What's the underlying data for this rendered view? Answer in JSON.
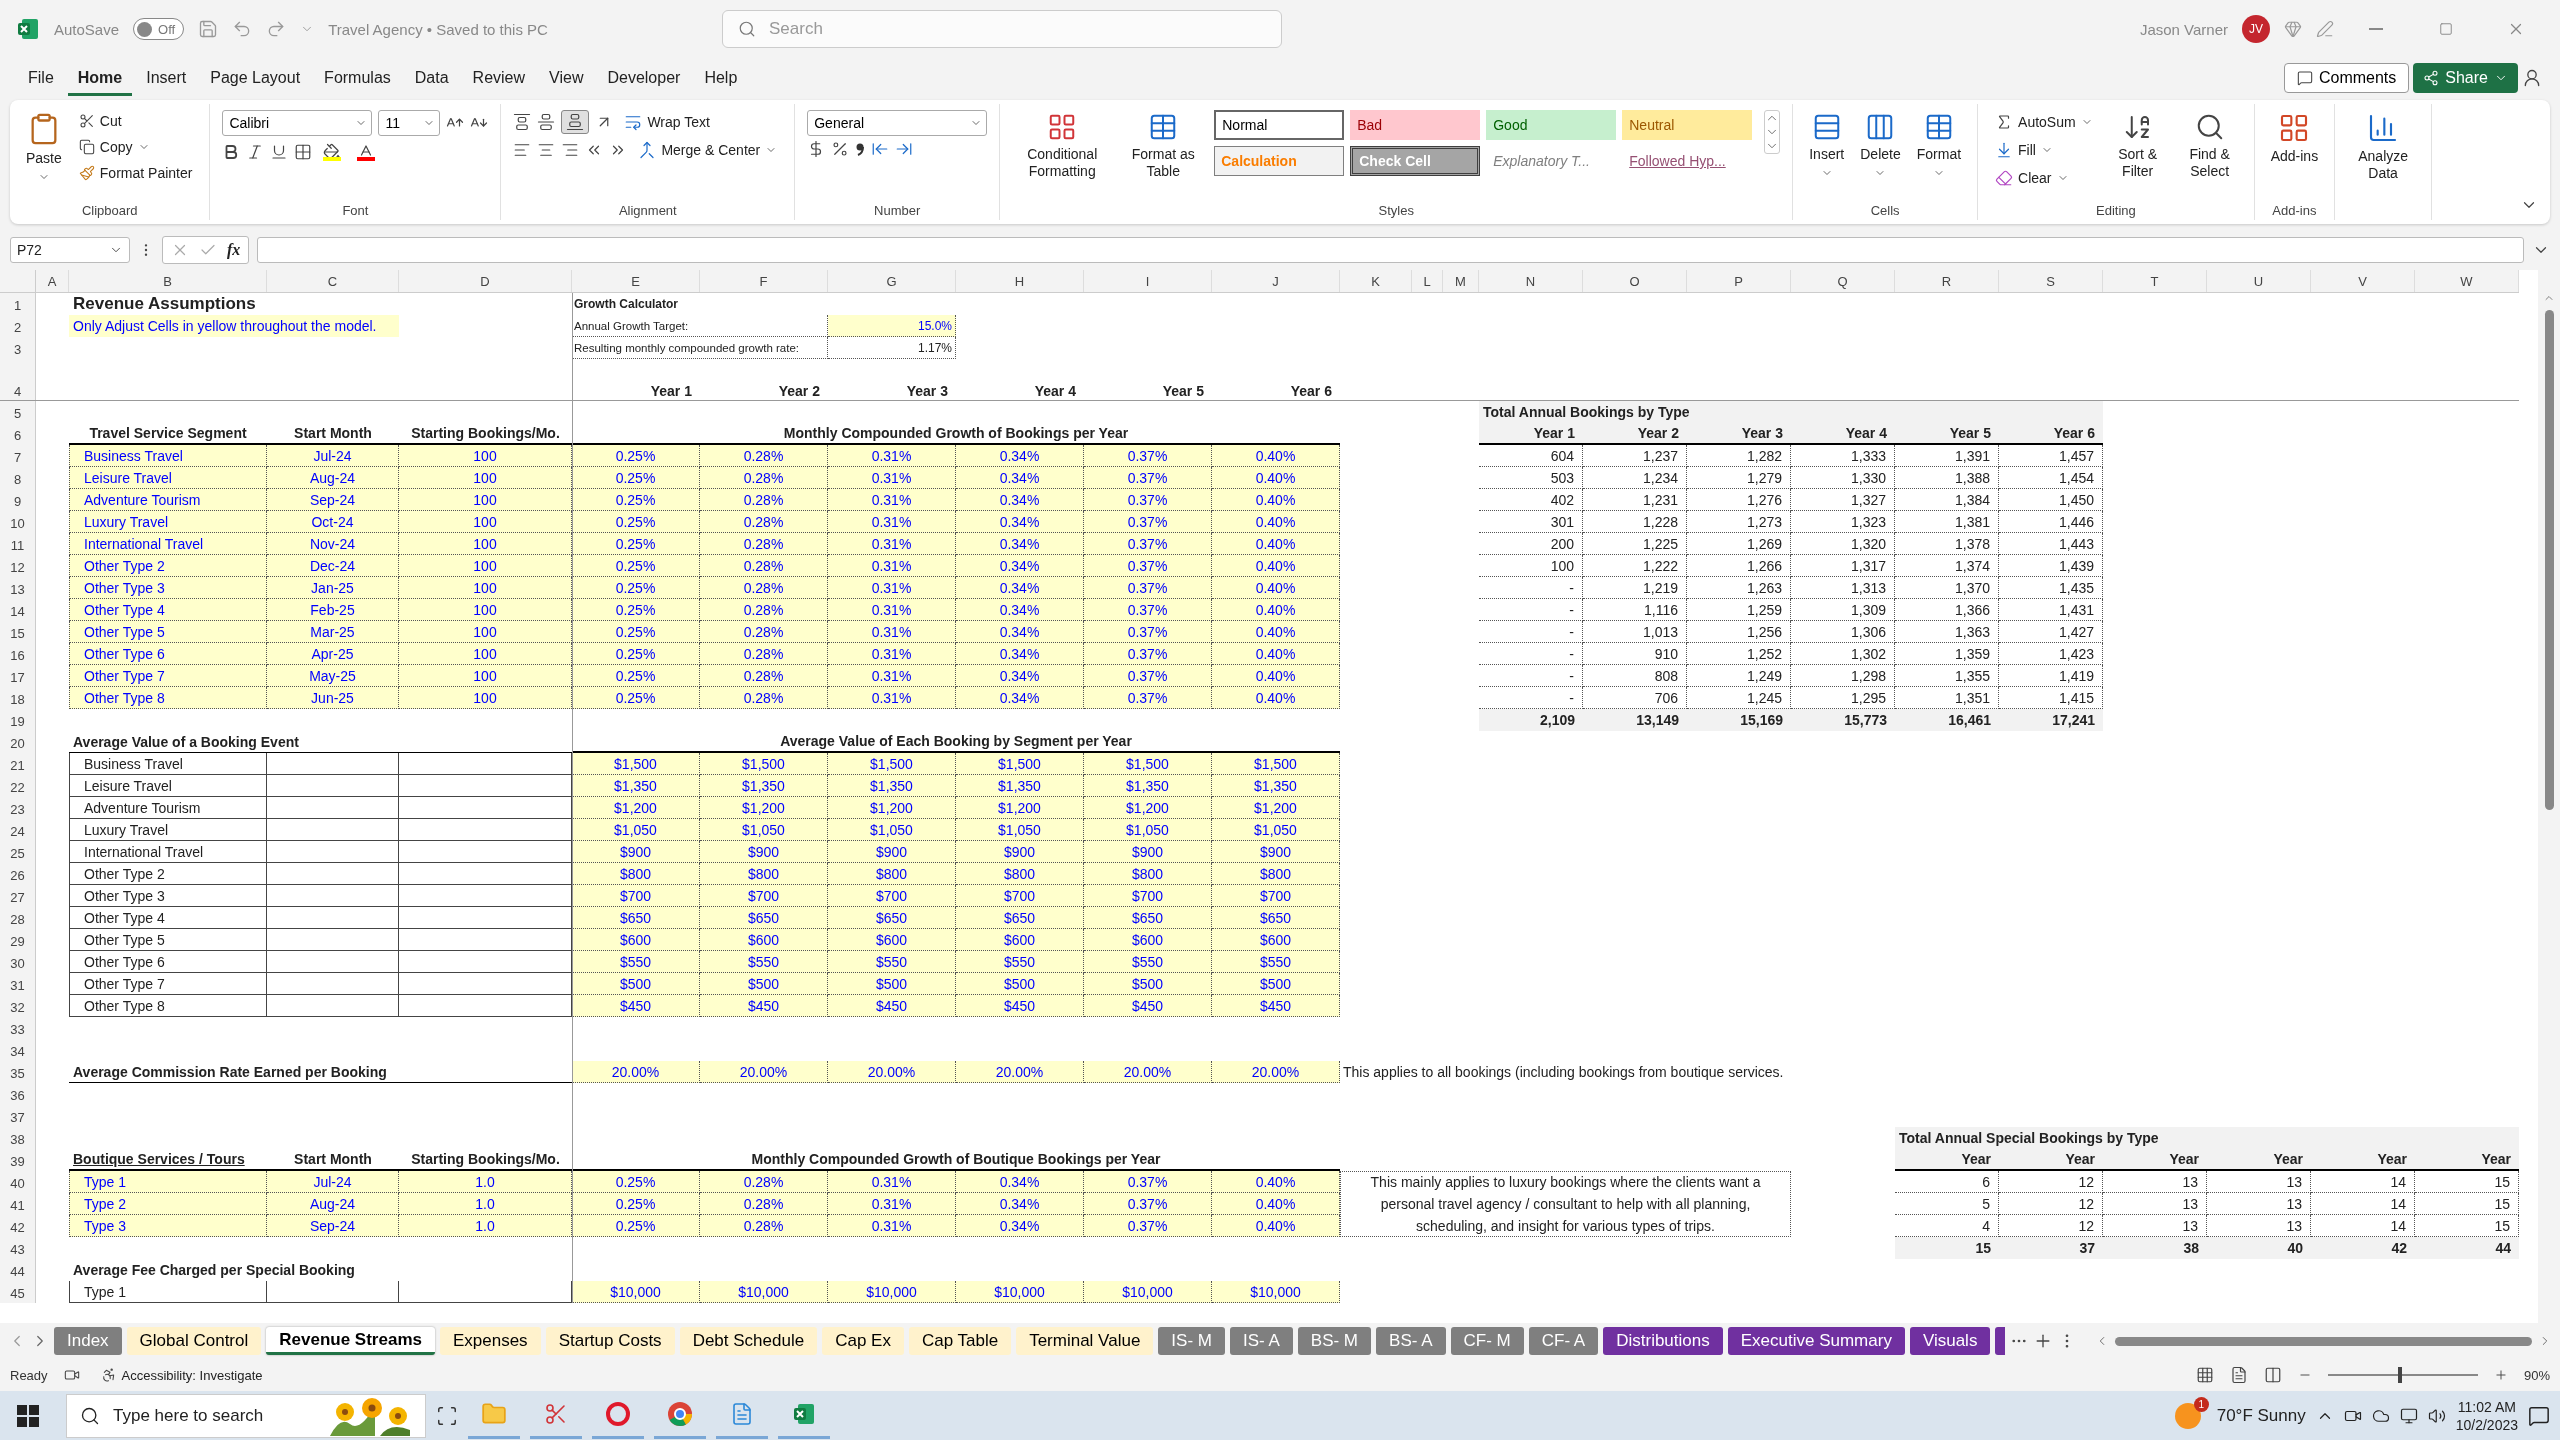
{
  "app": {
    "autosave_label": "AutoSave",
    "autosave_state": "Off",
    "autosave_on": false,
    "document_title": "Travel Agency • Saved to this PC",
    "search_placeholder": "Search",
    "user_name": "Jason Varner",
    "user_initials": "JV"
  },
  "menu_tabs": [
    {
      "label": "File",
      "selected": false
    },
    {
      "label": "Home",
      "selected": true
    },
    {
      "label": "Insert",
      "selected": false
    },
    {
      "label": "Page Layout",
      "selected": false
    },
    {
      "label": "Formulas",
      "selected": false
    },
    {
      "label": "Data",
      "selected": false
    },
    {
      "label": "Review",
      "selected": false
    },
    {
      "label": "View",
      "selected": false
    },
    {
      "label": "Developer",
      "selected": false
    },
    {
      "label": "Help",
      "selected": false
    }
  ],
  "comments_button": "Comments",
  "share_button": "Share",
  "ribbon": {
    "clipboard": {
      "label": "Clipboard",
      "paste": "Paste",
      "cut": "Cut",
      "copy": "Copy",
      "format_painter": "Format Painter"
    },
    "font": {
      "label": "Font",
      "font_name": "Calibri",
      "font_size": "11"
    },
    "alignment": {
      "label": "Alignment",
      "wrap_text": "Wrap Text",
      "merge": "Merge & Center",
      "bottom_align_selected": true
    },
    "number": {
      "label": "Number",
      "format": "General"
    },
    "styles": {
      "label": "Styles",
      "conditional": "Conditional Formatting",
      "format_table": "Format as Table",
      "cell_styles": [
        {
          "label": "Normal",
          "kind": "normal",
          "selected": true
        },
        {
          "label": "Bad",
          "kind": "bad",
          "selected": false
        },
        {
          "label": "Good",
          "kind": "good",
          "selected": false
        },
        {
          "label": "Neutral",
          "kind": "neutral",
          "selected": false
        },
        {
          "label": "Calculation",
          "kind": "calculation",
          "selected": false
        },
        {
          "label": "Check Cell",
          "kind": "check",
          "selected": false
        },
        {
          "label": "Explanatory T...",
          "kind": "explanatory",
          "selected": false
        },
        {
          "label": "Followed Hyp...",
          "kind": "followed",
          "selected": false
        }
      ]
    },
    "cells": {
      "label": "Cells",
      "insert": "Insert",
      "delete": "Delete",
      "format": "Format"
    },
    "editing": {
      "label": "Editing",
      "autosum": "AutoSum",
      "fill": "Fill",
      "clear": "Clear",
      "sort": "Sort & Filter",
      "find": "Find & Select"
    },
    "addins": {
      "label": "Add-ins",
      "button": "Add-ins"
    },
    "analyze": {
      "button": "Analyze Data"
    }
  },
  "formula_bar": {
    "name_box": "P72",
    "fx": "fx"
  },
  "columns": [
    "A",
    "B",
    "C",
    "D",
    "E",
    "F",
    "G",
    "H",
    "I",
    "J",
    "K",
    "L",
    "M",
    "N",
    "O",
    "P",
    "Q",
    "R",
    "S",
    "T",
    "U",
    "V",
    "W"
  ],
  "row_numbers": [
    "1",
    "2",
    "3",
    "4",
    "5",
    "6",
    "7",
    "8",
    "9",
    "10",
    "11",
    "12",
    "13",
    "14",
    "15",
    "16",
    "17",
    "18",
    "19",
    "20",
    "21",
    "22",
    "23",
    "24",
    "25",
    "26",
    "27",
    "28",
    "29",
    "30",
    "31",
    "32",
    "33",
    "34",
    "35",
    "36",
    "37",
    "38",
    "39",
    "40",
    "41",
    "42",
    "43",
    "44",
    "45"
  ],
  "sheet": {
    "title": "Revenue Assumptions",
    "instruction": "Only Adjust Cells in yellow throughout the model.",
    "calculator": {
      "title": "Growth Calculator",
      "rows": [
        {
          "label": "Annual Growth Target:",
          "value": "15.0%",
          "kind": "input"
        },
        {
          "label": "Resulting monthly compounded growth rate:",
          "value": "1.17%",
          "kind": "result"
        }
      ]
    },
    "year_headers": [
      "Year 1",
      "Year 2",
      "Year 3",
      "Year 4",
      "Year 5",
      "Year 6"
    ],
    "segments": {
      "headers": [
        "Travel Service Segment",
        "Start Month",
        "Starting Bookings/Mo."
      ],
      "growth_header": "Monthly Compounded Growth of Bookings per Year",
      "rows": [
        [
          "Business Travel",
          "Jul-24",
          "100",
          "0.25%",
          "0.28%",
          "0.31%",
          "0.34%",
          "0.37%",
          "0.40%"
        ],
        [
          "Leisure Travel",
          "Aug-24",
          "100",
          "0.25%",
          "0.28%",
          "0.31%",
          "0.34%",
          "0.37%",
          "0.40%"
        ],
        [
          "Adventure Tourism",
          "Sep-24",
          "100",
          "0.25%",
          "0.28%",
          "0.31%",
          "0.34%",
          "0.37%",
          "0.40%"
        ],
        [
          "Luxury Travel",
          "Oct-24",
          "100",
          "0.25%",
          "0.28%",
          "0.31%",
          "0.34%",
          "0.37%",
          "0.40%"
        ],
        [
          "International Travel",
          "Nov-24",
          "100",
          "0.25%",
          "0.28%",
          "0.31%",
          "0.34%",
          "0.37%",
          "0.40%"
        ],
        [
          "Other Type 2",
          "Dec-24",
          "100",
          "0.25%",
          "0.28%",
          "0.31%",
          "0.34%",
          "0.37%",
          "0.40%"
        ],
        [
          "Other Type 3",
          "Jan-25",
          "100",
          "0.25%",
          "0.28%",
          "0.31%",
          "0.34%",
          "0.37%",
          "0.40%"
        ],
        [
          "Other Type 4",
          "Feb-25",
          "100",
          "0.25%",
          "0.28%",
          "0.31%",
          "0.34%",
          "0.37%",
          "0.40%"
        ],
        [
          "Other Type 5",
          "Mar-25",
          "100",
          "0.25%",
          "0.28%",
          "0.31%",
          "0.34%",
          "0.37%",
          "0.40%"
        ],
        [
          "Other Type 6",
          "Apr-25",
          "100",
          "0.25%",
          "0.28%",
          "0.31%",
          "0.34%",
          "0.37%",
          "0.40%"
        ],
        [
          "Other Type 7",
          "May-25",
          "100",
          "0.25%",
          "0.28%",
          "0.31%",
          "0.34%",
          "0.37%",
          "0.40%"
        ],
        [
          "Other Type 8",
          "Jun-25",
          "100",
          "0.25%",
          "0.28%",
          "0.31%",
          "0.34%",
          "0.37%",
          "0.40%"
        ]
      ]
    },
    "annual_bookings": {
      "title": "Total Annual Bookings by Type",
      "years": [
        "Year 1",
        "Year 2",
        "Year 3",
        "Year 4",
        "Year 5",
        "Year 6"
      ],
      "rows": [
        [
          "604",
          "1,237",
          "1,282",
          "1,333",
          "1,391",
          "1,457"
        ],
        [
          "503",
          "1,234",
          "1,279",
          "1,330",
          "1,388",
          "1,454"
        ],
        [
          "402",
          "1,231",
          "1,276",
          "1,327",
          "1,384",
          "1,450"
        ],
        [
          "301",
          "1,228",
          "1,273",
          "1,323",
          "1,381",
          "1,446"
        ],
        [
          "200",
          "1,225",
          "1,269",
          "1,320",
          "1,378",
          "1,443"
        ],
        [
          "100",
          "1,222",
          "1,266",
          "1,317",
          "1,374",
          "1,439"
        ],
        [
          "-",
          "1,219",
          "1,263",
          "1,313",
          "1,370",
          "1,435"
        ],
        [
          "-",
          "1,116",
          "1,259",
          "1,309",
          "1,366",
          "1,431"
        ],
        [
          "-",
          "1,013",
          "1,256",
          "1,306",
          "1,363",
          "1,427"
        ],
        [
          "-",
          "910",
          "1,252",
          "1,302",
          "1,359",
          "1,423"
        ],
        [
          "-",
          "808",
          "1,249",
          "1,298",
          "1,355",
          "1,419"
        ],
        [
          "-",
          "706",
          "1,245",
          "1,295",
          "1,351",
          "1,415"
        ]
      ],
      "totals": [
        "2,109",
        "13,149",
        "15,169",
        "15,773",
        "16,461",
        "17,241"
      ]
    },
    "booking_values": {
      "header": "Average Value of a Booking Event",
      "values_header": "Average Value of Each Booking by Segment per Year",
      "rows": [
        [
          "Business Travel",
          "$1,500",
          "$1,500",
          "$1,500",
          "$1,500",
          "$1,500",
          "$1,500"
        ],
        [
          "Leisure Travel",
          "$1,350",
          "$1,350",
          "$1,350",
          "$1,350",
          "$1,350",
          "$1,350"
        ],
        [
          "Adventure Tourism",
          "$1,200",
          "$1,200",
          "$1,200",
          "$1,200",
          "$1,200",
          "$1,200"
        ],
        [
          "Luxury Travel",
          "$1,050",
          "$1,050",
          "$1,050",
          "$1,050",
          "$1,050",
          "$1,050"
        ],
        [
          "International Travel",
          "$900",
          "$900",
          "$900",
          "$900",
          "$900",
          "$900"
        ],
        [
          "Other Type 2",
          "$800",
          "$800",
          "$800",
          "$800",
          "$800",
          "$800"
        ],
        [
          "Other Type 3",
          "$700",
          "$700",
          "$700",
          "$700",
          "$700",
          "$700"
        ],
        [
          "Other Type 4",
          "$650",
          "$650",
          "$650",
          "$650",
          "$650",
          "$650"
        ],
        [
          "Other Type 5",
          "$600",
          "$600",
          "$600",
          "$600",
          "$600",
          "$600"
        ],
        [
          "Other Type 6",
          "$550",
          "$550",
          "$550",
          "$550",
          "$550",
          "$550"
        ],
        [
          "Other Type 7",
          "$500",
          "$500",
          "$500",
          "$500",
          "$500",
          "$500"
        ],
        [
          "Other Type 8",
          "$450",
          "$450",
          "$450",
          "$450",
          "$450",
          "$450"
        ]
      ]
    },
    "commission": {
      "label": "Average Commission Rate Earned per Booking",
      "values": [
        "20.00%",
        "20.00%",
        "20.00%",
        "20.00%",
        "20.00%",
        "20.00%"
      ],
      "note": "This applies to all bookings (including bookings from boutique services."
    },
    "special_bookings": {
      "title": "Total Annual Special Bookings by Type",
      "years": [
        "Year",
        "Year",
        "Year",
        "Year",
        "Year",
        "Year"
      ],
      "rows": [
        [
          "6",
          "12",
          "13",
          "13",
          "14",
          "15"
        ],
        [
          "5",
          "12",
          "13",
          "13",
          "14",
          "15"
        ],
        [
          "4",
          "12",
          "13",
          "13",
          "14",
          "15"
        ]
      ],
      "totals": [
        "15",
        "37",
        "38",
        "40",
        "42",
        "44"
      ]
    },
    "boutique": {
      "headers": [
        "Boutique Services / Tours",
        "Start Month",
        "Starting Bookings/Mo."
      ],
      "growth_header": "Monthly Compounded Growth of Boutique Bookings per Year",
      "rows": [
        [
          "Type 1",
          "Jul-24",
          "1.0",
          "0.25%",
          "0.28%",
          "0.31%",
          "0.34%",
          "0.37%",
          "0.40%"
        ],
        [
          "Type 2",
          "Aug-24",
          "1.0",
          "0.25%",
          "0.28%",
          "0.31%",
          "0.34%",
          "0.37%",
          "0.40%"
        ],
        [
          "Type 3",
          "Sep-24",
          "1.0",
          "0.25%",
          "0.28%",
          "0.31%",
          "0.34%",
          "0.37%",
          "0.40%"
        ]
      ],
      "note": "This mainly applies to luxury bookings where the clients want a personal travel agency / consultant to help with all planning, scheduling, and insight for various types of trips."
    },
    "fee": {
      "label": "Average Fee Charged per Special Booking",
      "rows": [
        [
          "Type 1",
          "$10,000",
          "$10,000",
          "$10,000",
          "$10,000",
          "$10,000",
          "$10,000"
        ]
      ]
    }
  },
  "sheet_tabs": [
    {
      "label": "Index",
      "color": "#7f7f7f",
      "selected": false
    },
    {
      "label": "Global Control",
      "color": "#fff2cc",
      "selected": false
    },
    {
      "label": "Revenue Streams",
      "selected": true
    },
    {
      "label": "Expenses",
      "color": "#fff2cc",
      "selected": false
    },
    {
      "label": "Startup Costs",
      "color": "#fff2cc",
      "selected": false
    },
    {
      "label": "Debt Schedule",
      "color": "#fff2cc",
      "selected": false
    },
    {
      "label": "Cap Ex",
      "color": "#fff2cc",
      "selected": false
    },
    {
      "label": "Cap Table",
      "color": "#fff2cc",
      "selected": false
    },
    {
      "label": "Terminal Value",
      "color": "#fff2cc",
      "selected": false
    },
    {
      "label": "IS- M",
      "color": "#7f7f7f",
      "selected": false
    },
    {
      "label": "IS- A",
      "color": "#7f7f7f",
      "selected": false
    },
    {
      "label": "BS- M",
      "color": "#7f7f7f",
      "selected": false
    },
    {
      "label": "BS- A",
      "color": "#7f7f7f",
      "selected": false
    },
    {
      "label": "CF- M",
      "color": "#7f7f7f",
      "selected": false
    },
    {
      "label": "CF- A",
      "color": "#7f7f7f",
      "selected": false
    },
    {
      "label": "Distributions",
      "color": "#7030a0",
      "selected": false
    },
    {
      "label": "Executive Summary",
      "color": "#7030a0",
      "selected": false
    },
    {
      "label": "Visuals",
      "color": "#7030a0",
      "selected": false
    },
    {
      "color": "#7030a0",
      "selected": false
    }
  ],
  "status": {
    "ready": "Ready",
    "accessibility": "Accessibility: Investigate",
    "zoom": "90%",
    "zoom_slider": {
      "level": 0.47
    }
  },
  "taskbar": {
    "search_placeholder": "Type here to search",
    "weather": "70°F  Sunny",
    "weather_badge": "1",
    "time": "11:02 AM",
    "date": "10/2/2023"
  }
}
